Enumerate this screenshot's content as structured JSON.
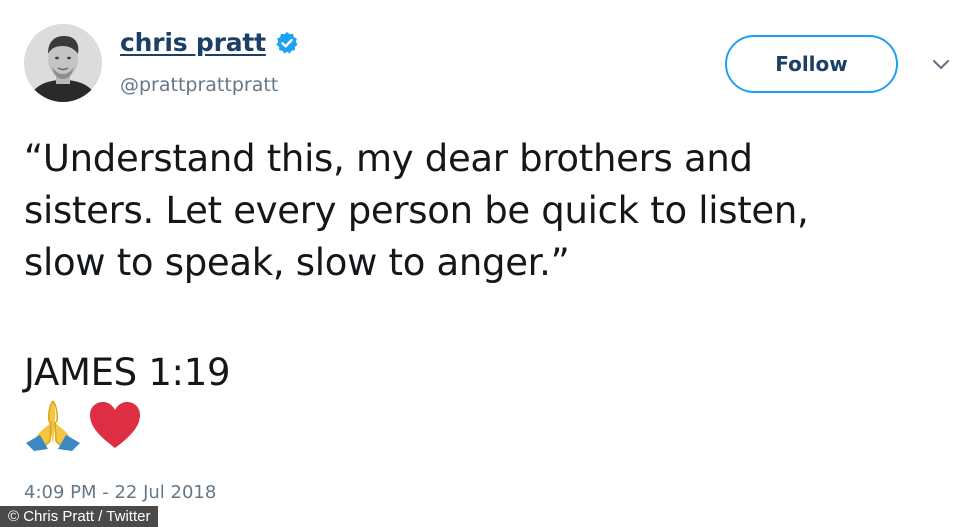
{
  "author": {
    "display_name": "chris pratt",
    "handle": "@prattprattpratt",
    "verified": true,
    "avatar_icon": "profile-photo"
  },
  "actions": {
    "follow_label": "Follow",
    "menu_icon": "chevron-down-icon"
  },
  "tweet": {
    "text_lines": [
      "“Understand this, my dear brothers and",
      "sisters. Let every person be quick to listen,",
      "slow to speak, slow to anger.”"
    ],
    "verse": "JAMES 1:19",
    "emojis": [
      "folded-hands-emoji",
      "red-heart-emoji"
    ],
    "timestamp": "4:09 PM - 22 Jul 2018"
  },
  "credit": "© Chris Pratt / Twitter",
  "colors": {
    "name": "#1b3f66",
    "accent": "#1da1f2",
    "secondary_text": "#657786",
    "body_text": "#14171a"
  }
}
